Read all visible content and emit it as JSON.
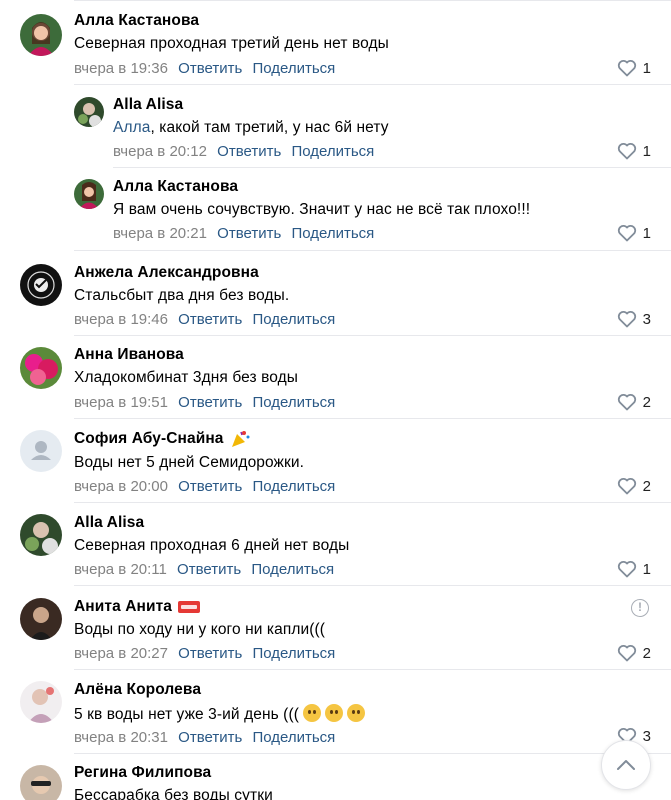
{
  "actions": {
    "reply": "Ответить",
    "share": "Поделиться"
  },
  "comments": [
    {
      "author": "Алла Кастанова",
      "text": "Северная проходная третий день нет воды",
      "time": "вчера в 19:36",
      "likes": "1"
    },
    {
      "author": "Alla Alisa",
      "mention": "Алла",
      "text": ", какой там третий, у нас 6й нету",
      "time": "вчера в 20:12",
      "likes": "1"
    },
    {
      "author": "Алла Кастанова",
      "text": "Я вам очень сочувствую. Значит у нас не всё так плохо!!!",
      "time": "вчера в 20:21",
      "likes": "1"
    },
    {
      "author": "Анжела Александровна",
      "text": "Стальсбыт два дня без воды.",
      "time": "вчера в 19:46",
      "likes": "3"
    },
    {
      "author": "Анна Иванова",
      "text": "Хладокомбинат 3дня без воды",
      "time": "вчера в 19:51",
      "likes": "2"
    },
    {
      "author": "София Абу-Снайна",
      "text": "Воды нет 5 дней Семидорожки.",
      "time": "вчера в 20:00",
      "likes": "2"
    },
    {
      "author": "Alla Alisa",
      "text": "Северная проходная 6 дней нет воды",
      "time": "вчера в 20:11",
      "likes": "1"
    },
    {
      "author": "Анита Анита",
      "text": "Воды по ходу ни у кого ни капли(((",
      "time": "вчера в 20:27",
      "likes": "2"
    },
    {
      "author": "Алёна Королева",
      "text": "5 кв воды нет уже 3-ий день (((",
      "time": "вчера в 20:31",
      "likes": "3"
    },
    {
      "author": "Регина Филипова",
      "text": "Бессарабка без воды сутки"
    }
  ],
  "colors": {
    "link": "#2a5885",
    "meta": "#828282",
    "divider": "#e7e8ec"
  }
}
